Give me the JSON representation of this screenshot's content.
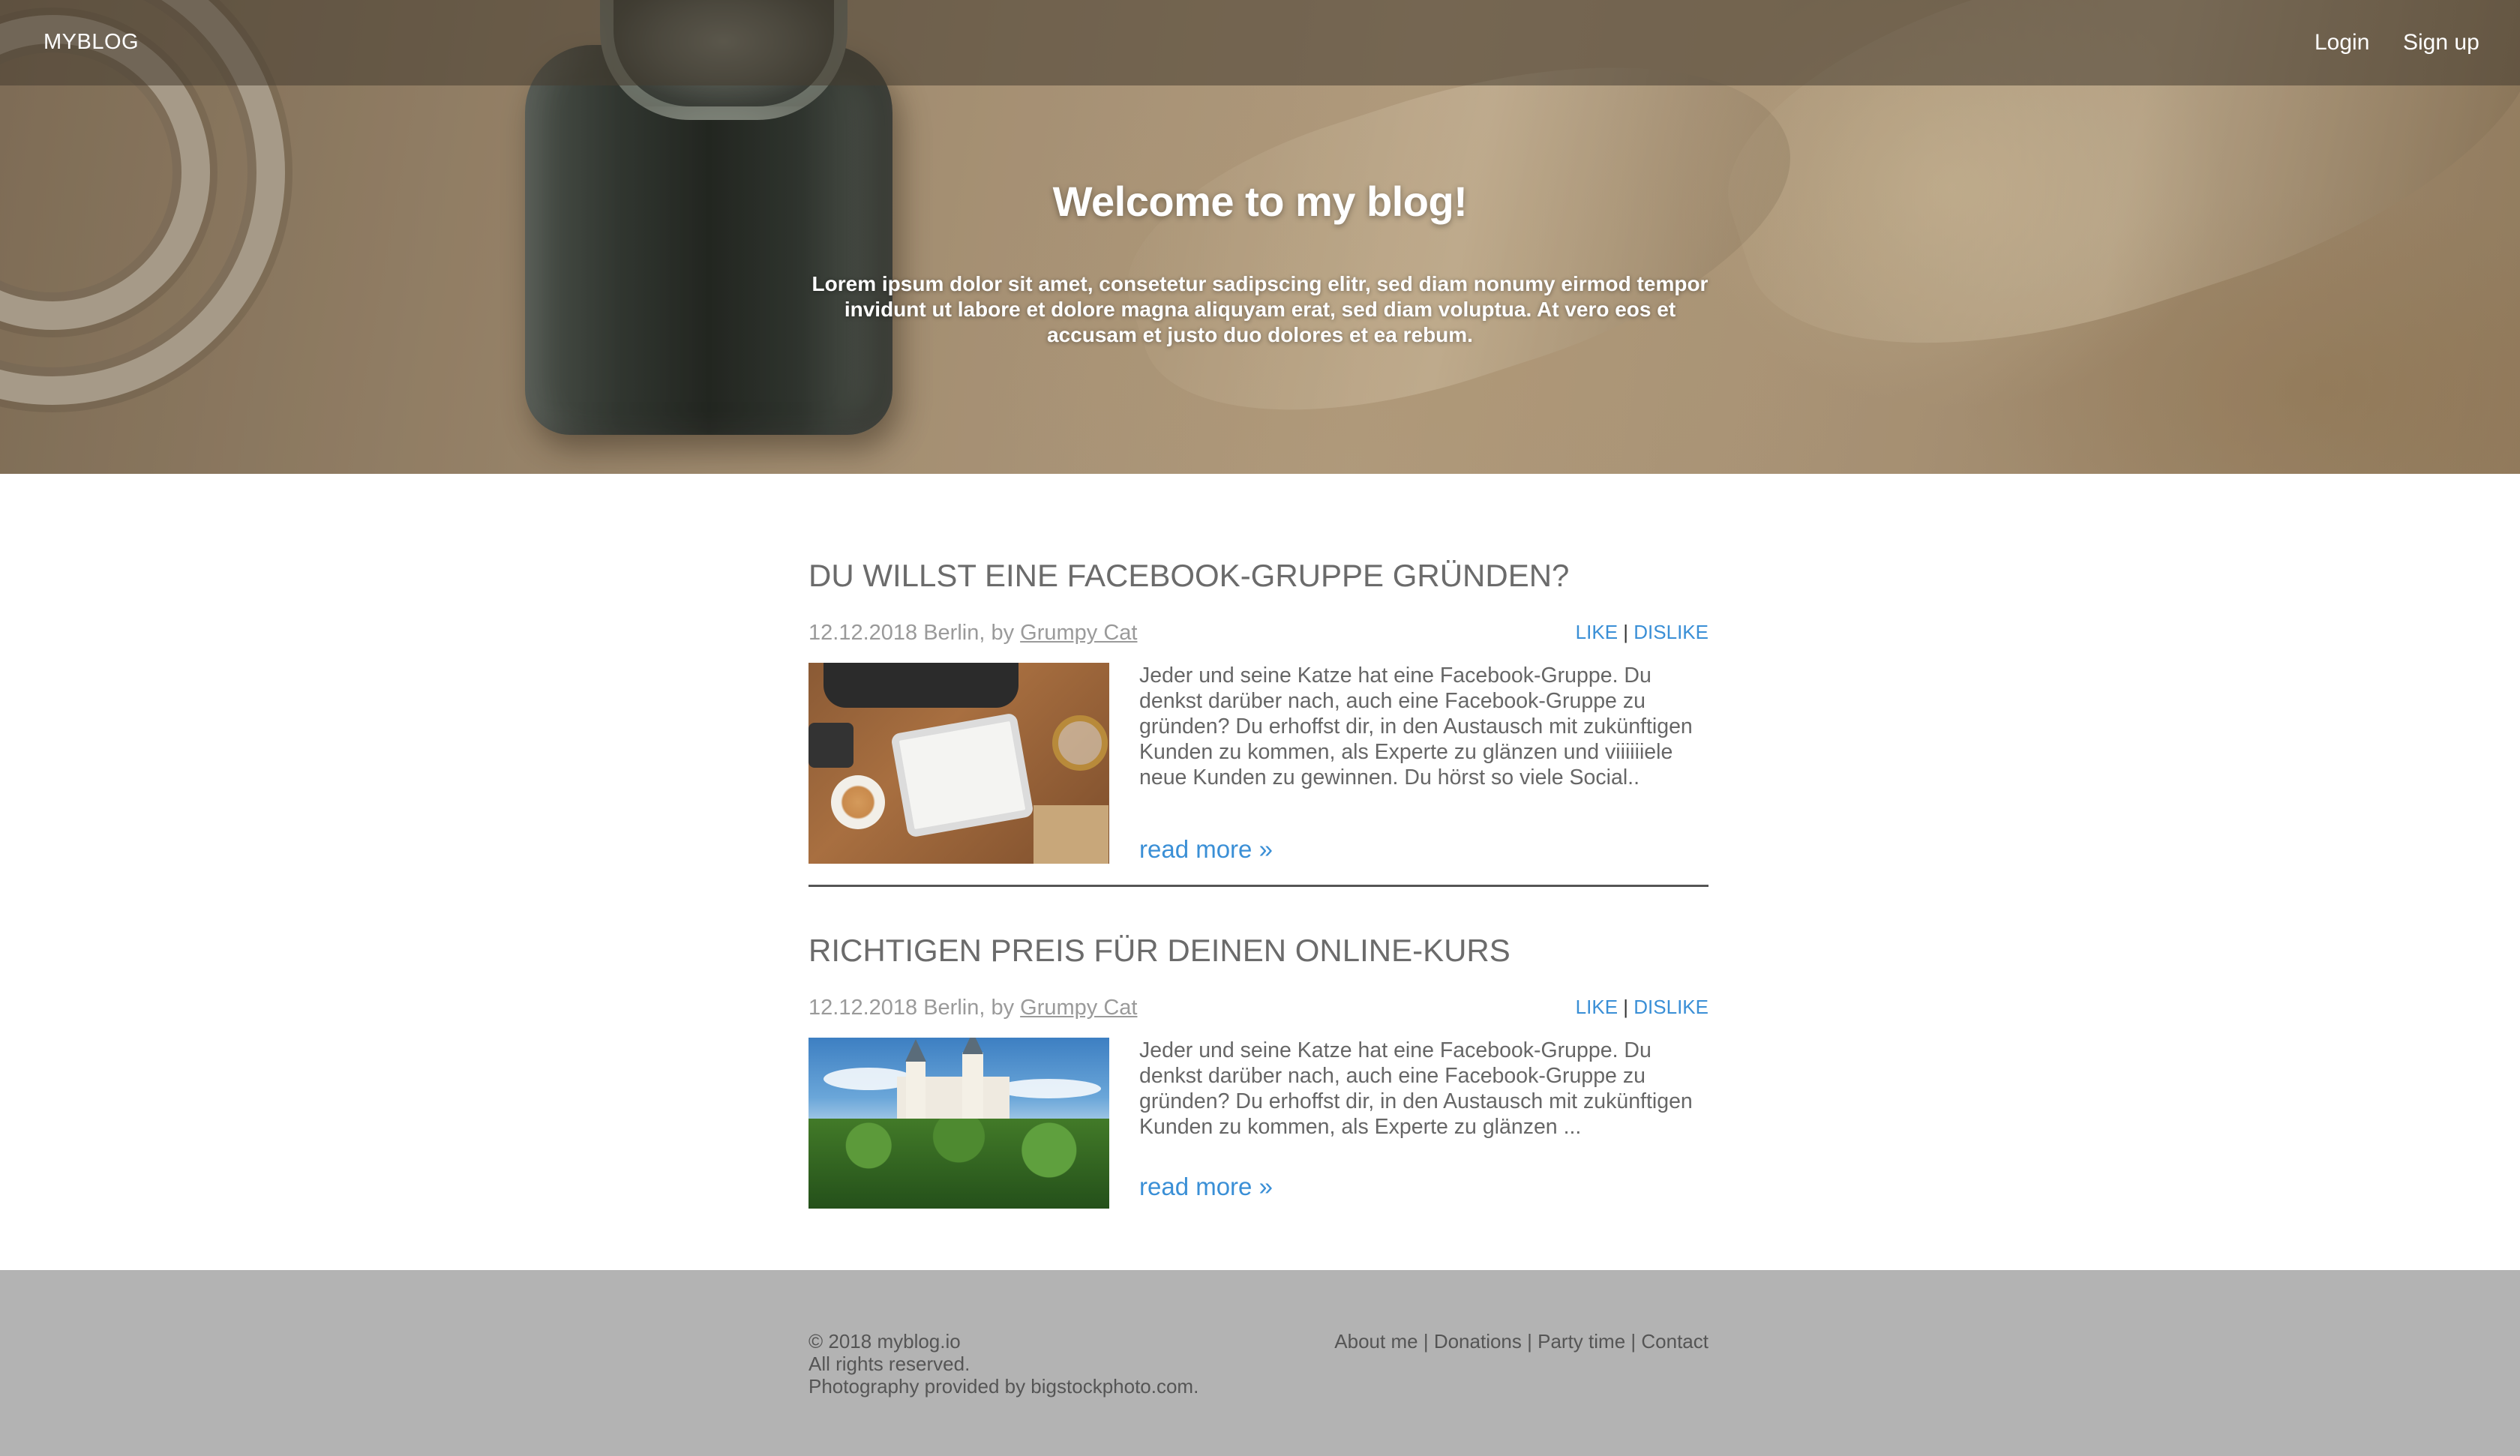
{
  "header": {
    "brand": "MYBLOG",
    "login_label": "Login",
    "signup_label": "Sign up"
  },
  "hero": {
    "title": "Welcome to my blog!",
    "text": "Lorem ipsum dolor sit amet, consetetur sadipscing elitr, sed diam nonumy eirmod tempor invidunt ut labore et dolore magna aliquyam erat, sed diam voluptua. At vero eos et accusam et justo duo dolores et ea rebum."
  },
  "posts": [
    {
      "title": "DU WILLST EINE FACEBOOK-GRUPPE GRÜNDEN?",
      "date_location": "12.12.2018 Berlin, by ",
      "author": "Grumpy Cat",
      "like_label": "LIKE",
      "separator": "|",
      "dislike_label": "DISLIKE",
      "excerpt": "Jeder und seine Katze hat eine Facebook-Gruppe. Du denkst darüber nach, auch eine Facebook-Gruppe zu gründen? Du erhoffst dir, in den Austausch mit zukünftigen Kunden zu kommen, als Experte zu glänzen und viiiiiiele neue Kunden zu gewinnen. Du hörst so viele Social..",
      "read_more": "read more »"
    },
    {
      "title": "RICHTIGEN PREIS FÜR DEINEN ONLINE-KURS",
      "date_location": "12.12.2018 Berlin, by ",
      "author": "Grumpy Cat",
      "like_label": "LIKE",
      "separator": "|",
      "dislike_label": "DISLIKE",
      "excerpt": "Jeder und seine Katze hat eine Facebook-Gruppe. Du denkst darüber nach, auch eine Facebook-Gruppe zu gründen? Du erhoffst dir, in den Austausch mit zukünftigen Kunden zu kommen, als Experte zu glänzen ...",
      "read_more": "read more »"
    }
  ],
  "footer": {
    "copyright": "© 2018 myblog.io",
    "rights": "All rights reserved.",
    "photo_credit": "Photography provided by bigstockphoto.com.",
    "links": [
      "About me",
      "Donations",
      "Party time",
      "Contact"
    ],
    "separator": "|"
  },
  "colors": {
    "link": "#3a8fd6",
    "footer_bg": "#b3b3b3",
    "title_text": "#6b6b6b"
  }
}
